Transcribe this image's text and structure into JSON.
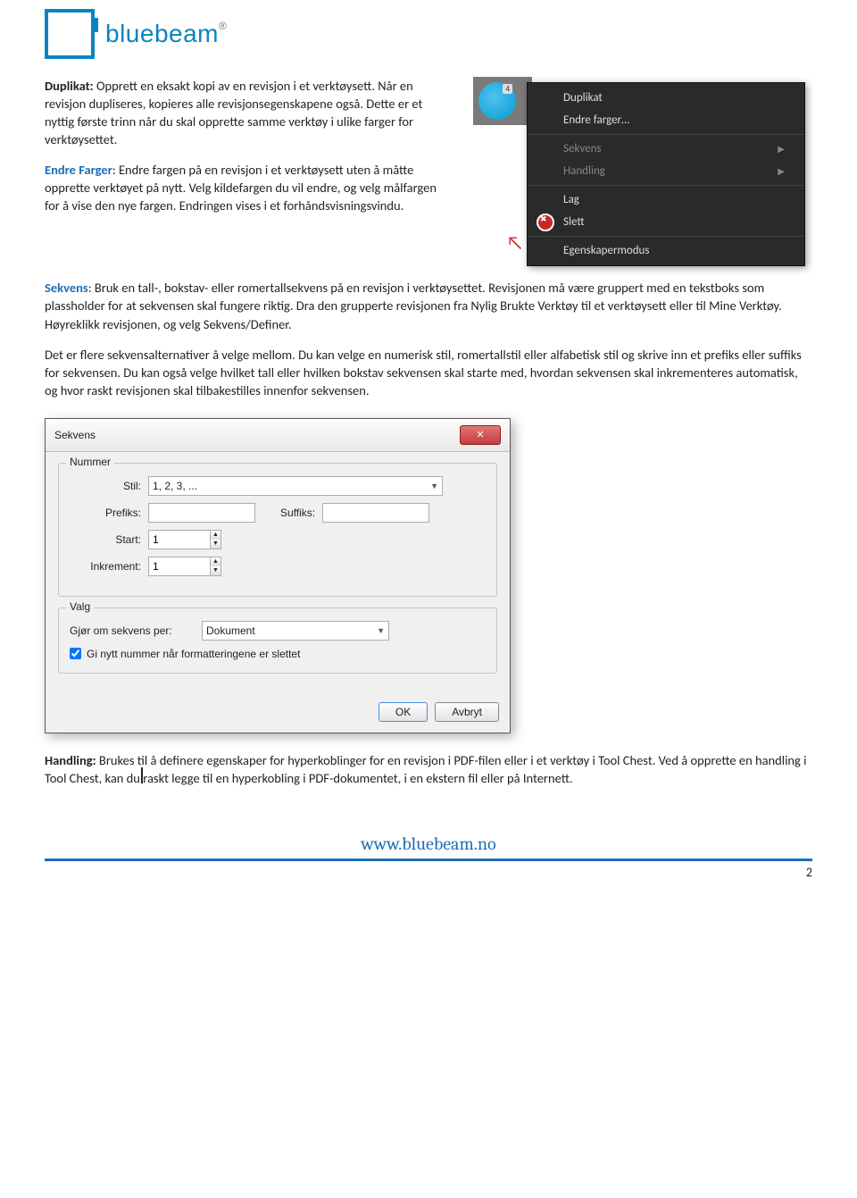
{
  "brand": {
    "name": "bluebeam",
    "reg": "®"
  },
  "thumb": {
    "badge": "4"
  },
  "context_menu": {
    "items": [
      {
        "label": "Duplikat",
        "enabled": true
      },
      {
        "label": "Endre farger…",
        "enabled": true
      },
      {
        "sep": true
      },
      {
        "label": "Sekvens",
        "enabled": false,
        "arrow": true
      },
      {
        "label": "Handling",
        "enabled": false,
        "arrow": true
      },
      {
        "sep": true
      },
      {
        "label": "Lag",
        "enabled": true
      },
      {
        "label": "Slett",
        "enabled": true,
        "icon": "del"
      },
      {
        "sep": true
      },
      {
        "label": "Egenskapermodus",
        "enabled": true
      }
    ]
  },
  "para": {
    "duplikat_label": "Duplikat:",
    "duplikat_text": " Opprett en eksakt kopi av en revisjon i et verktøysett. Når en revisjon dupliseres, kopieres alle revisjonsegenskapene også. Dette er et nyttig første trinn når du skal opprette samme verktøy i ulike farger for verktøysettet.",
    "endre_label": "Endre Farger",
    "endre_text": ": Endre fargen på en revisjon i et verktøysett uten å måtte opprette verktøyet på nytt. Velg kildefargen du vil endre, og velg målfargen for å vise den nye fargen. Endringen vises i et forhåndsvisningsvindu.",
    "sekvens_label": "Sekvens",
    "sekvens_text": ": Bruk en tall-, bokstav- eller romertallsekvens på en revisjon i verktøysettet. Revisjonen må være gruppert med en tekstboks som plassholder for at sekvensen skal fungere riktig. Dra den grupperte revisjonen fra Nylig Brukte Verktøy til et verktøysett eller til Mine Verktøy. Høyreklikk revisjonen, og velg Sekvens/Definer.",
    "sekvens_p2": "Det er flere sekvensalternativer å velge mellom. Du kan velge en numerisk stil, romertallstil eller alfabetisk stil og skrive inn et prefiks eller suffiks for sekvensen. Du kan også velge hvilket tall eller hvilken bokstav sekvensen skal starte med, hvordan sekvensen skal inkrementeres automatisk, og hvor raskt revisjonen skal tilbakestilles innenfor sekvensen.",
    "handling_label": "Handling:",
    "handling_text": " Brukes til å definere egenskaper for hyperkoblinger for en revisjon i PDF-filen eller i et verktøy i Tool Chest. Ved å opprette en handling i Tool Chest, kan du raskt legge til en hyperkobling i PDF-dokumentet, i en ekstern fil eller på Internett."
  },
  "dialog": {
    "title": "Sekvens",
    "group_number": "Nummer",
    "group_options": "Valg",
    "labels": {
      "stil": "Stil:",
      "prefiks": "Prefiks:",
      "suffiks": "Suffiks:",
      "start": "Start:",
      "inkrement": "Inkrement:",
      "reset_per": "Gjør om sekvens per:",
      "renumber": "Gi nytt nummer når formatteringene er slettet"
    },
    "values": {
      "stil": "1, 2, 3, ...",
      "prefiks": "",
      "suffiks": "",
      "start": "1",
      "inkrement": "1",
      "reset_per": "Dokument",
      "renumber_checked": true
    },
    "buttons": {
      "ok": "OK",
      "cancel": "Avbryt"
    }
  },
  "footer": {
    "url": "www.bluebeam.no",
    "page": "2"
  }
}
